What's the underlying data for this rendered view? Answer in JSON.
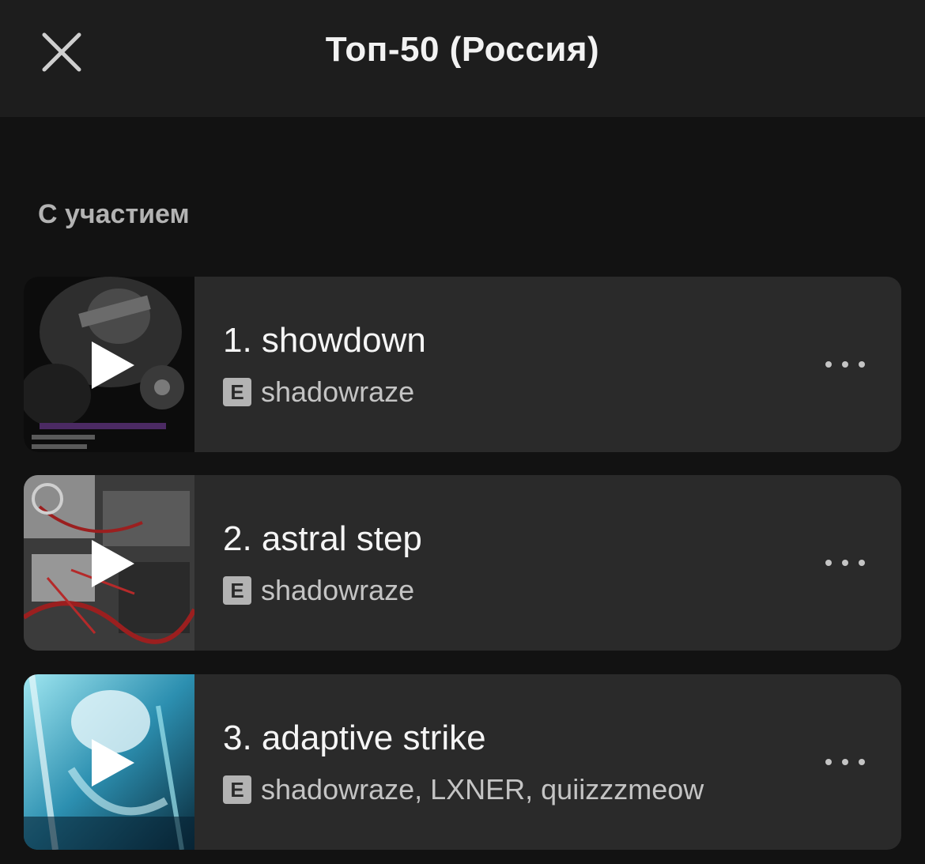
{
  "header": {
    "title": "Топ-50 (Россия)",
    "close_icon": "close-icon"
  },
  "section": {
    "heading": "С участием"
  },
  "tracks": [
    {
      "number_title": "1. showdown",
      "explicit_label": "E",
      "artists": "shadowraze",
      "cover_theme": "dark-gray",
      "cover_colors": [
        "#0c0c0c",
        "#3a3a3a",
        "#6b6b6b",
        "#4b2a63"
      ]
    },
    {
      "number_title": "2. astral step",
      "explicit_label": "E",
      "artists": "shadowraze",
      "cover_theme": "red-collage",
      "cover_colors": [
        "#3b3b3b",
        "#8c8c8c",
        "#9b1f1f",
        "#d6d6d6"
      ]
    },
    {
      "number_title": "3. adaptive strike",
      "explicit_label": "E",
      "artists": "shadowraze, LXNER, quiizzzmeow",
      "cover_theme": "cyan-ice",
      "cover_colors": [
        "#0a2a3a",
        "#2c8fb0",
        "#9fe6f0",
        "#e8f8fb"
      ]
    }
  ],
  "colors": {
    "background": "#121212",
    "header_bg": "#1d1d1d",
    "card_bg": "#2a2a2a",
    "text_primary": "#f5f5f5",
    "text_secondary": "#c4c4c4"
  }
}
